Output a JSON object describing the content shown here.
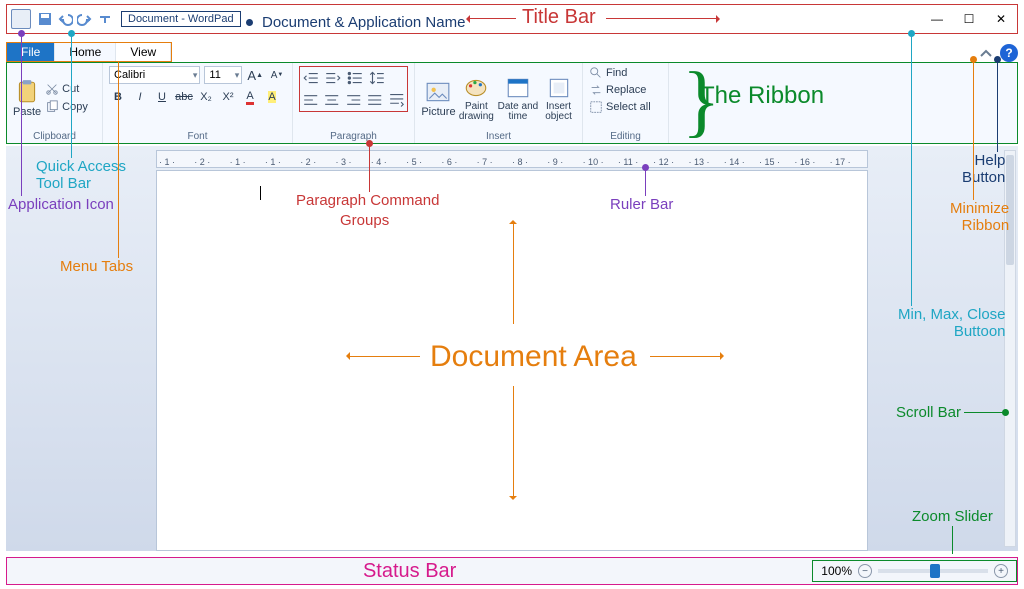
{
  "app": {
    "title": "Document - WordPad"
  },
  "tabs": {
    "file": "File",
    "home": "Home",
    "view": "View"
  },
  "clipboard": {
    "paste": "Paste",
    "cut": "Cut",
    "copy": "Copy",
    "group": "Clipboard"
  },
  "font": {
    "family": "Calibri",
    "size": "11",
    "group": "Font",
    "grow": "A",
    "shrink": "A",
    "bold": "B",
    "italic": "I",
    "under": "U",
    "strike": "abc",
    "sub": "X₂",
    "sup": "X²",
    "color": "A",
    "hilite": "A"
  },
  "paragraph": {
    "group": "Paragraph"
  },
  "insert": {
    "picture": "Picture",
    "paint": "Paint drawing",
    "date": "Date and time",
    "object": "Insert object",
    "group": "Insert"
  },
  "editing": {
    "find": "Find",
    "replace": "Replace",
    "select": "Select all",
    "group": "Editing"
  },
  "zoom": {
    "pct": "100%",
    "minus": "−",
    "plus": "+"
  },
  "ruler": [
    "1",
    "2",
    "1",
    "1",
    "2",
    "3",
    "4",
    "5",
    "6",
    "7",
    "8",
    "9",
    "10",
    "11",
    "12",
    "13",
    "14",
    "15",
    "16",
    "17"
  ],
  "labels": {
    "title_bar": "Title Bar",
    "doc_app": "Document & Application Name",
    "qat": "Quick Access\nTool Bar",
    "app_icon": "Application Icon",
    "menu_tabs": "Menu Tabs",
    "para_groups_1": "Paragraph Command",
    "para_groups_2": "Groups",
    "ruler": "Ruler Bar",
    "ribbon": "The Ribbon",
    "help": "Help\nButton",
    "min_ribbon": "Minimize\nRibbon",
    "winbtns": "Min, Max, Close\nButtoon",
    "scroll": "Scroll Bar",
    "zoom": "Zoom Slider",
    "doc_area": "Document Area",
    "status": "Status Bar"
  }
}
